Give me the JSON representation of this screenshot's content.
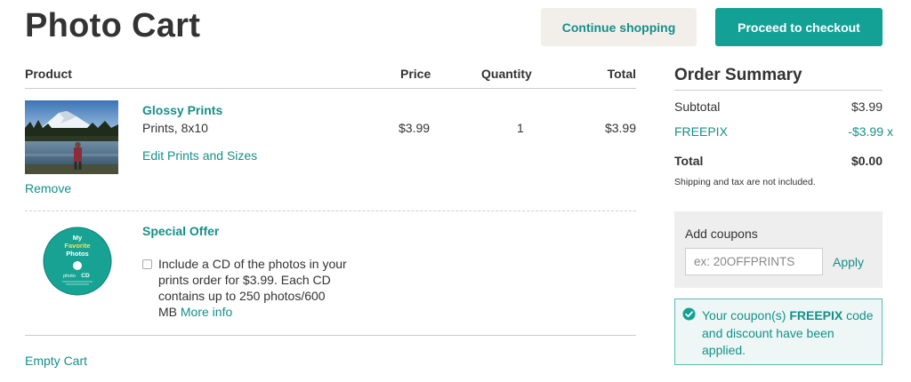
{
  "page": {
    "title": "Photo Cart"
  },
  "header": {
    "continue_label": "Continue shopping",
    "checkout_label": "Proceed to checkout"
  },
  "table": {
    "columns": [
      "Product",
      "Price",
      "Quantity",
      "Total"
    ]
  },
  "items": [
    {
      "name": "Glossy Prints",
      "description": "Prints, 8x10",
      "edit_label": "Edit Prints and Sizes",
      "remove_label": "Remove",
      "price": "$3.99",
      "quantity": "1",
      "total": "$3.99",
      "thumbnail_icon": "landscape-photo-thumbnail"
    }
  ],
  "offer": {
    "title": "Special Offer",
    "text": "Include a CD of the photos in your prints order for $3.99. Each CD contains up to 250 photos/600 MB",
    "more_info_label": "More info",
    "checked": false,
    "cd_label_line1": "My",
    "cd_label_line2": "Favorite",
    "cd_label_line3": "Photos",
    "cd_brand": "photo",
    "cd_text": "CD"
  },
  "cart": {
    "empty_label": "Empty Cart"
  },
  "summary": {
    "title": "Order Summary",
    "subtotal_label": "Subtotal",
    "subtotal_value": "$3.99",
    "coupon_code": "FREEPIX",
    "coupon_discount": "-$3.99",
    "coupon_remove": "x",
    "total_label": "Total",
    "total_value": "$0.00",
    "note": "Shipping and tax are not included."
  },
  "coupons": {
    "label": "Add coupons",
    "placeholder": "ex: 20OFFPRINTS",
    "value": "",
    "apply_label": "Apply"
  },
  "notice": {
    "prefix": "Your coupon(s) ",
    "code": "FREEPIX",
    "suffix": " code and discount have been applied."
  },
  "colors": {
    "accent": "#13908a",
    "checkout_button": "#13a195",
    "continue_button": "#f2efeb",
    "coupon_panel": "#eeeeee",
    "notice_bg": "#eef7f6"
  }
}
